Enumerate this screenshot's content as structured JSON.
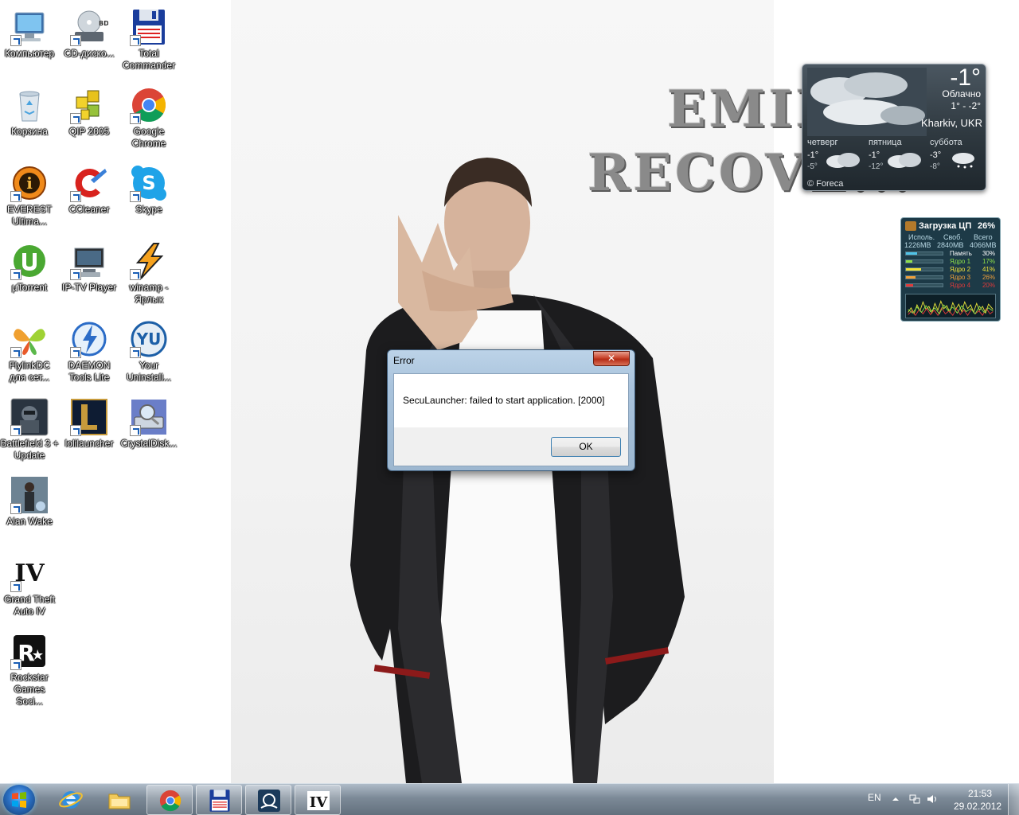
{
  "desktop": {
    "icons": [
      {
        "label": "Компьютер"
      },
      {
        "label": "CD-диско..."
      },
      {
        "label": "Total Commander"
      },
      {
        "label": "Корзина"
      },
      {
        "label": "QIP 2005"
      },
      {
        "label": "Google Chrome"
      },
      {
        "label": "EVEREST Ultima..."
      },
      {
        "label": "CCleaner"
      },
      {
        "label": "Skype"
      },
      {
        "label": "µTorrent"
      },
      {
        "label": "IP-TV Player"
      },
      {
        "label": "winamp - Ярлык"
      },
      {
        "label": "FlylinkDC для сет..."
      },
      {
        "label": "DAEMON Tools Lite"
      },
      {
        "label": "Your Uninstall..."
      },
      {
        "label": "Battlefield 3 + Update"
      },
      {
        "label": "lolilauncher"
      },
      {
        "label": "CrystalDisk..."
      },
      {
        "label": "Alan Wake"
      },
      {
        "label": "Grand Theft Auto IV"
      },
      {
        "label": "Rockstar Games Soci..."
      }
    ],
    "icon_badges": {
      "cd": "BD",
      "gta": "IV"
    },
    "wallpaper_text": [
      "EMIN",
      "RECOVE..."
    ]
  },
  "weather": {
    "temp": "-1°",
    "condition": "Облачно",
    "range": "1° - -2°",
    "location": "Kharkiv, UKR",
    "forecast": [
      {
        "day": "четверг",
        "hi": "-1°",
        "lo": "-5°"
      },
      {
        "day": "пятница",
        "hi": "-1°",
        "lo": "-12°"
      },
      {
        "day": "суббота",
        "hi": "-3°",
        "lo": "-8°"
      }
    ],
    "credit": "© Foreca"
  },
  "cpu_gadget": {
    "title": "Загрузка ЦП",
    "total": "26%",
    "headers": [
      "Исполь.",
      "Своб.",
      "Всего"
    ],
    "memory_values": [
      "1226MB",
      "2840MB",
      "4066MB"
    ],
    "rows": [
      {
        "name": "Память",
        "pct": "30%",
        "value": 0.3,
        "color": "#4fc3e8"
      },
      {
        "name": "Ядро 1",
        "pct": "17%",
        "value": 0.17,
        "color": "#8ee04a"
      },
      {
        "name": "Ядро 2",
        "pct": "41%",
        "value": 0.41,
        "color": "#f0e23a"
      },
      {
        "name": "Ядро 3",
        "pct": "26%",
        "value": 0.26,
        "color": "#f0a03a"
      },
      {
        "name": "Ядро 4",
        "pct": "20%",
        "value": 0.2,
        "color": "#e03a3a"
      }
    ]
  },
  "dialog": {
    "title": "Error",
    "close": "✕",
    "message": "SecuLauncher: failed to start application. [2000]",
    "ok_label": "OK"
  },
  "taskbar": {
    "apps": [
      "Internet Explorer",
      "Windows Explorer",
      "Google Chrome",
      "Total Commander",
      "Steam",
      "Grand Theft Auto IV"
    ],
    "gta_badge": "IV",
    "language": "EN",
    "time": "21:53",
    "date": "29.02.2012"
  }
}
